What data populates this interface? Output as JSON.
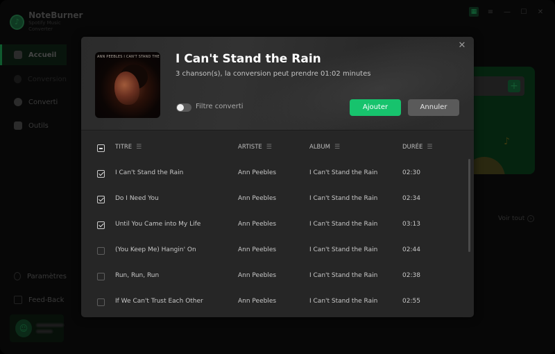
{
  "app": {
    "name": "NoteBurner",
    "subtitle": "Spotify Music Converter"
  },
  "sidebar": {
    "items": [
      {
        "label": "Accueil",
        "icon": "home-icon",
        "active": true
      },
      {
        "label": "Conversion",
        "icon": "convert-icon",
        "active": false
      },
      {
        "label": "Converti",
        "icon": "clock-icon",
        "active": false
      },
      {
        "label": "Outils",
        "icon": "toolbox-icon",
        "active": false
      }
    ],
    "bottom_items": [
      {
        "label": "Paramètres",
        "icon": "gear-icon"
      },
      {
        "label": "Feed-Back",
        "icon": "mail-icon"
      }
    ]
  },
  "window_controls": {
    "grid": "▦",
    "menu": "≡",
    "minimize": "—",
    "maximize": "☐",
    "close": "✕"
  },
  "background": {
    "see_all": "Voir tout",
    "see_all_icon": "›",
    "promo_plus": "+"
  },
  "modal": {
    "title": "I Can't Stand the Rain",
    "info": "3 chanson(s), la conversion peut prendre 01:02 minutes",
    "cover_caption": "ANN PEEBLES  I CAN'T STAND THE RAIN",
    "close_icon": "✕",
    "filter_label": "Filtre converti",
    "filter_on": false,
    "add_label": "Ajouter",
    "cancel_label": "Annuler",
    "accent_color": "#17c36d",
    "columns": {
      "title": "TITRE",
      "artist": "ARTISTE",
      "album": "ALBUM",
      "duration": "DURÉE",
      "sort_icon": "☰"
    },
    "select_all_state": "partial",
    "tracks": [
      {
        "checked": true,
        "title": "I Can't Stand the Rain",
        "artist": "Ann Peebles",
        "album": "I Can't Stand the Rain",
        "duration": "02:30"
      },
      {
        "checked": true,
        "title": "Do I Need You",
        "artist": "Ann Peebles",
        "album": "I Can't Stand the Rain",
        "duration": "02:34"
      },
      {
        "checked": true,
        "title": "Until You Came into My Life",
        "artist": "Ann Peebles",
        "album": "I Can't Stand the Rain",
        "duration": "03:13"
      },
      {
        "checked": false,
        "title": "(You Keep Me) Hangin' On",
        "artist": "Ann Peebles",
        "album": "I Can't Stand the Rain",
        "duration": "02:44"
      },
      {
        "checked": false,
        "title": "Run, Run, Run",
        "artist": "Ann Peebles",
        "album": "I Can't Stand the Rain",
        "duration": "02:38"
      },
      {
        "checked": false,
        "title": "If We Can't Trust Each Other",
        "artist": "Ann Peebles",
        "album": "I Can't Stand the Rain",
        "duration": "02:55"
      }
    ]
  }
}
